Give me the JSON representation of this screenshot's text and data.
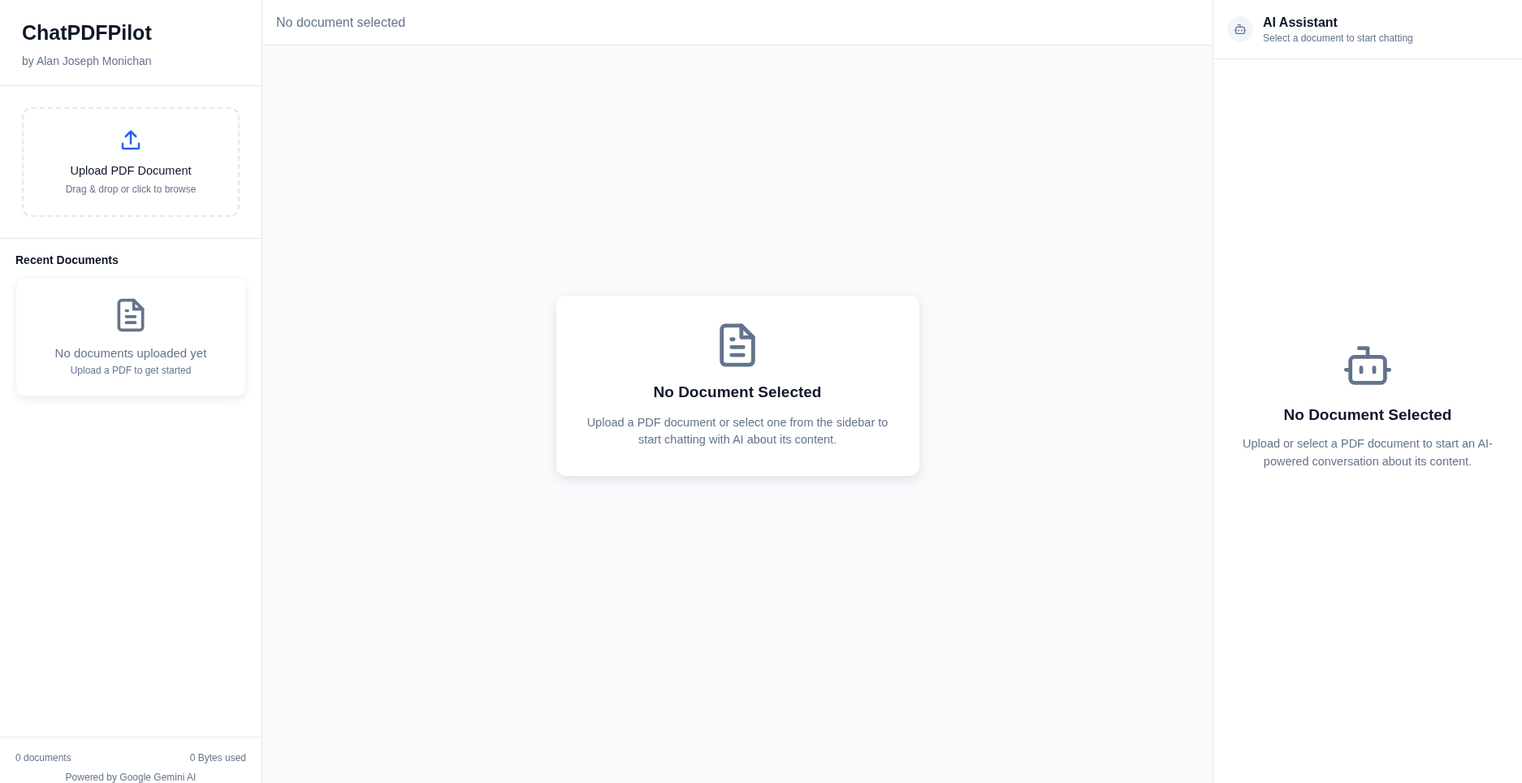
{
  "sidebar": {
    "app_title": "ChatPDFPilot",
    "author": "by Alan Joseph Monichan",
    "upload": {
      "title": "Upload PDF Document",
      "hint": "Drag & drop or click to browse"
    },
    "recent": {
      "heading": "Recent Documents",
      "empty_title": "No documents uploaded yet",
      "empty_hint": "Upload a PDF to get started"
    },
    "footer": {
      "count": "0 documents",
      "usage": "0 Bytes used",
      "powered_by": "Powered by Google Gemini AI"
    }
  },
  "main": {
    "header": "No document selected",
    "empty_title": "No Document Selected",
    "empty_text": "Upload a PDF document or select one from the sidebar to start chatting with AI about its content."
  },
  "assistant": {
    "title": "AI Assistant",
    "subtitle": "Select a document to start chatting",
    "empty_title": "No Document Selected",
    "empty_text": "Upload or select a PDF document to start an AI-powered conversation about its content."
  }
}
